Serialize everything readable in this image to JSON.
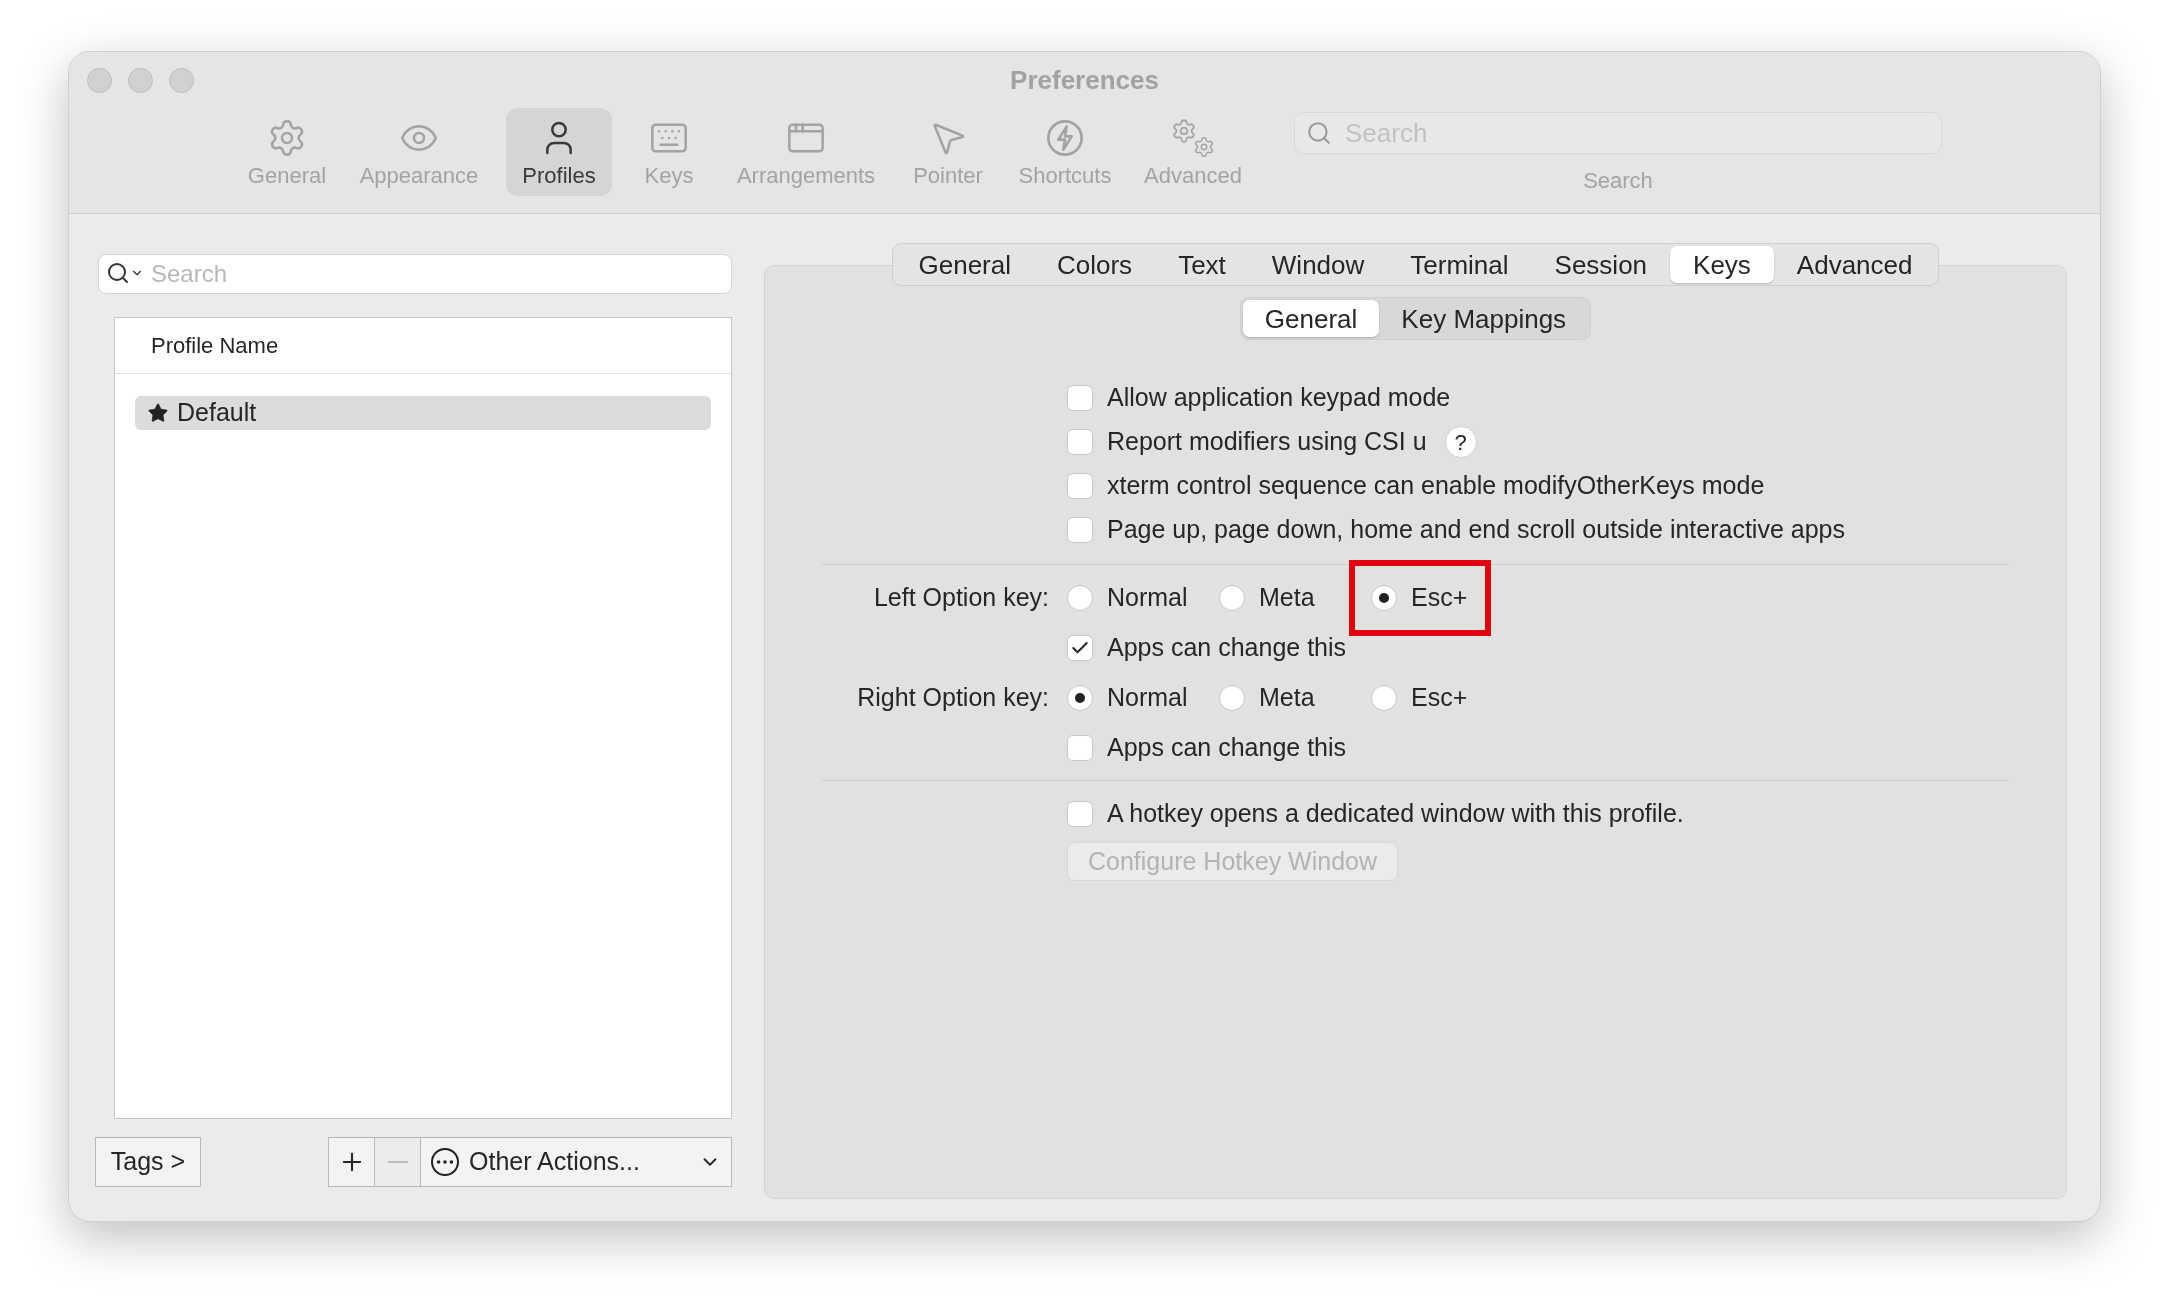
{
  "window": {
    "title": "Preferences"
  },
  "toolbar": {
    "items": [
      {
        "label": "General",
        "selected": false
      },
      {
        "label": "Appearance",
        "selected": false
      },
      {
        "label": "Profiles",
        "selected": true
      },
      {
        "label": "Keys",
        "selected": false
      },
      {
        "label": "Arrangements",
        "selected": false
      },
      {
        "label": "Pointer",
        "selected": false
      },
      {
        "label": "Shortcuts",
        "selected": false
      },
      {
        "label": "Advanced",
        "selected": false
      }
    ],
    "search": {
      "placeholder": "Search",
      "label": "Search"
    }
  },
  "profiles": {
    "search": {
      "placeholder": "Search"
    },
    "table": {
      "columns": [
        "Profile Name"
      ],
      "rows": [
        {
          "name": "Default",
          "default": true,
          "selected": true
        }
      ]
    },
    "tags_button": "Tags >",
    "remove_button": {
      "disabled": true
    },
    "actions_menu": "Other Actions..."
  },
  "tabs": [
    {
      "label": "General",
      "selected": false
    },
    {
      "label": "Colors",
      "selected": false
    },
    {
      "label": "Text",
      "selected": false
    },
    {
      "label": "Window",
      "selected": false
    },
    {
      "label": "Terminal",
      "selected": false
    },
    {
      "label": "Session",
      "selected": false
    },
    {
      "label": "Keys",
      "selected": true
    },
    {
      "label": "Advanced",
      "selected": false
    }
  ],
  "subtabs": [
    {
      "label": "General",
      "selected": true
    },
    {
      "label": "Key Mappings",
      "selected": false
    }
  ],
  "checkboxes": [
    {
      "label": "Allow application keypad mode",
      "checked": false
    },
    {
      "label": "Report modifiers using CSI u",
      "checked": false,
      "help": "?"
    },
    {
      "label": "xterm control sequence can enable modifyOtherKeys mode",
      "checked": false
    },
    {
      "label": "Page up, page down, home and end scroll outside interactive apps",
      "checked": false
    }
  ],
  "option_keys": [
    {
      "label": "Left Option key:",
      "options": [
        {
          "label": "Normal",
          "selected": false,
          "highlighted": false
        },
        {
          "label": "Meta",
          "selected": false,
          "highlighted": false
        },
        {
          "label": "Esc+",
          "selected": true,
          "highlighted": true
        }
      ],
      "apps_can_change": {
        "label": "Apps can change this",
        "checked": true
      }
    },
    {
      "label": "Right Option key:",
      "options": [
        {
          "label": "Normal",
          "selected": true,
          "highlighted": false
        },
        {
          "label": "Meta",
          "selected": false,
          "highlighted": false
        },
        {
          "label": "Esc+",
          "selected": false,
          "highlighted": false
        }
      ],
      "apps_can_change": {
        "label": "Apps can change this",
        "checked": false
      }
    }
  ],
  "hotkey": {
    "label": "A hotkey opens a dedicated window with this profile.",
    "checked": false,
    "button": {
      "label": "Configure Hotkey Window",
      "disabled": true
    }
  }
}
